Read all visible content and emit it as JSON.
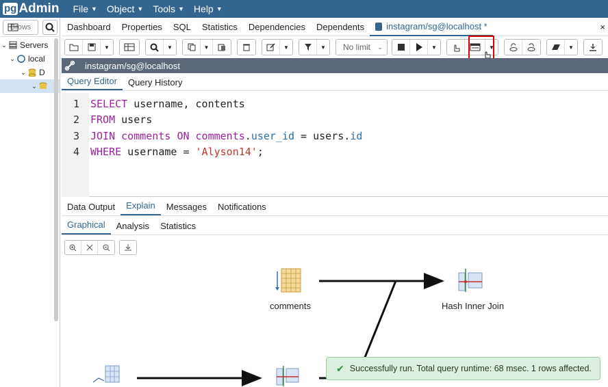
{
  "app": {
    "logo_pg": "pg",
    "logo_admin": "Admin"
  },
  "menu": [
    {
      "label": "File"
    },
    {
      "label": "Object"
    },
    {
      "label": "Tools"
    },
    {
      "label": "Help"
    }
  ],
  "browser": {
    "toolbar_label": "Brows",
    "tree": [
      {
        "label": "Servers",
        "expanded": true
      },
      {
        "label": "local",
        "expanded": true
      },
      {
        "label": "D",
        "expanded": true
      },
      {
        "label": "",
        "expanded": true
      }
    ]
  },
  "tabs": [
    {
      "label": "Dashboard"
    },
    {
      "label": "Properties"
    },
    {
      "label": "SQL"
    },
    {
      "label": "Statistics"
    },
    {
      "label": "Dependencies"
    },
    {
      "label": "Dependents"
    },
    {
      "label": "instagram/sg@localhost *",
      "active": true
    }
  ],
  "toolbar": {
    "limit_select": "No limit"
  },
  "connection": {
    "label": "instagram/sg@localhost"
  },
  "editor_tabs": [
    {
      "label": "Query Editor",
      "active": true
    },
    {
      "label": "Query History"
    }
  ],
  "code_lines": [
    {
      "number": "1",
      "tokens": [
        {
          "t": "SELECT",
          "c": "kw"
        },
        {
          "t": " username, contents",
          "c": ""
        }
      ]
    },
    {
      "number": "2",
      "tokens": [
        {
          "t": "FROM",
          "c": "kw"
        },
        {
          "t": " users",
          "c": ""
        }
      ]
    },
    {
      "number": "3",
      "tokens": [
        {
          "t": "JOIN",
          "c": "kw"
        },
        {
          "t": " ",
          "c": ""
        },
        {
          "t": "comments",
          "c": "kw"
        },
        {
          "t": " ",
          "c": ""
        },
        {
          "t": "ON",
          "c": "kw"
        },
        {
          "t": " ",
          "c": ""
        },
        {
          "t": "comments",
          "c": "kw"
        },
        {
          "t": ".",
          "c": ""
        },
        {
          "t": "user_id",
          "c": "fld"
        },
        {
          "t": " = users.",
          "c": ""
        },
        {
          "t": "id",
          "c": "fld"
        }
      ]
    },
    {
      "number": "4",
      "tokens": [
        {
          "t": "WHERE",
          "c": "kw"
        },
        {
          "t": " username = ",
          "c": ""
        },
        {
          "t": "'Alyson14'",
          "c": "str"
        },
        {
          "t": ";",
          "c": ""
        }
      ]
    }
  ],
  "results_tabs": [
    {
      "label": "Data Output"
    },
    {
      "label": "Explain",
      "active": true
    },
    {
      "label": "Messages"
    },
    {
      "label": "Notifications"
    }
  ],
  "explain_tabs": [
    {
      "label": "Graphical",
      "active": true
    },
    {
      "label": "Analysis"
    },
    {
      "label": "Statistics"
    }
  ],
  "graph": {
    "nodes": [
      {
        "label": "comments"
      },
      {
        "label": "Hash Inner Join"
      }
    ]
  },
  "toast": {
    "message": "Successfully run. Total query runtime: 68 msec. 1 rows affected."
  },
  "colors": {
    "header": "#326690",
    "accent": "#326690",
    "highlight": "#dd0000",
    "success_bg": "#ddefdf"
  }
}
